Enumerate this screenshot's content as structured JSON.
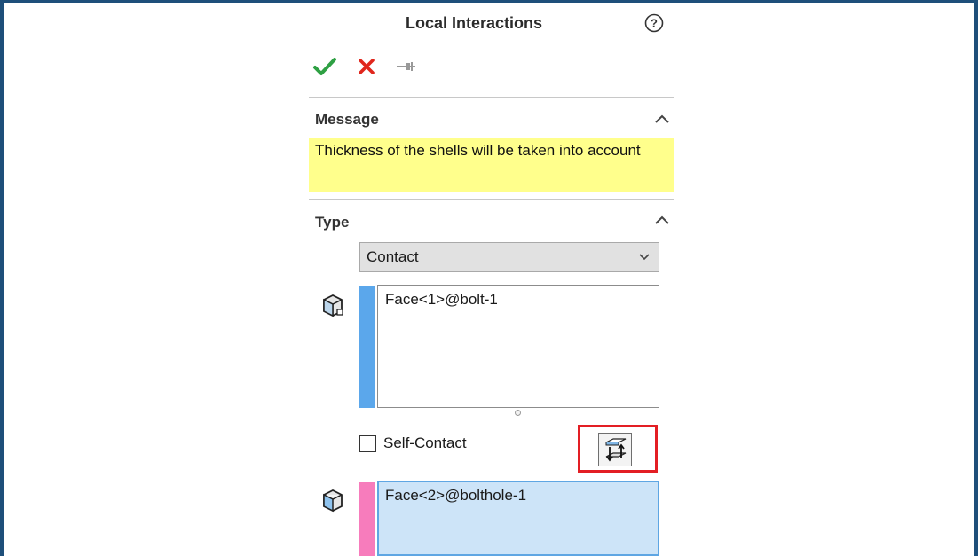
{
  "panel": {
    "title": "Local Interactions"
  },
  "toolbar": {
    "icons": [
      "check-icon",
      "close-icon",
      "pin-icon",
      "help-icon"
    ],
    "accent_ok": "#2ea043",
    "accent_cancel": "#e0261c"
  },
  "message_section": {
    "heading": "Message",
    "text": "Thickness of the shells will be taken into account",
    "background": "#ffff8c"
  },
  "type_section": {
    "heading": "Type",
    "type_select": {
      "value": "Contact"
    },
    "set1": {
      "value": "Face<1>@bolt-1",
      "color": "#5ba7eb"
    },
    "self_contact": {
      "label": "Self-Contact",
      "checked": false
    },
    "swap_icon": "swap-faces-icon",
    "highlight_color": "#e31e24",
    "set2": {
      "value": "Face<2>@bolthole-1",
      "color": "#f77cbc"
    }
  }
}
